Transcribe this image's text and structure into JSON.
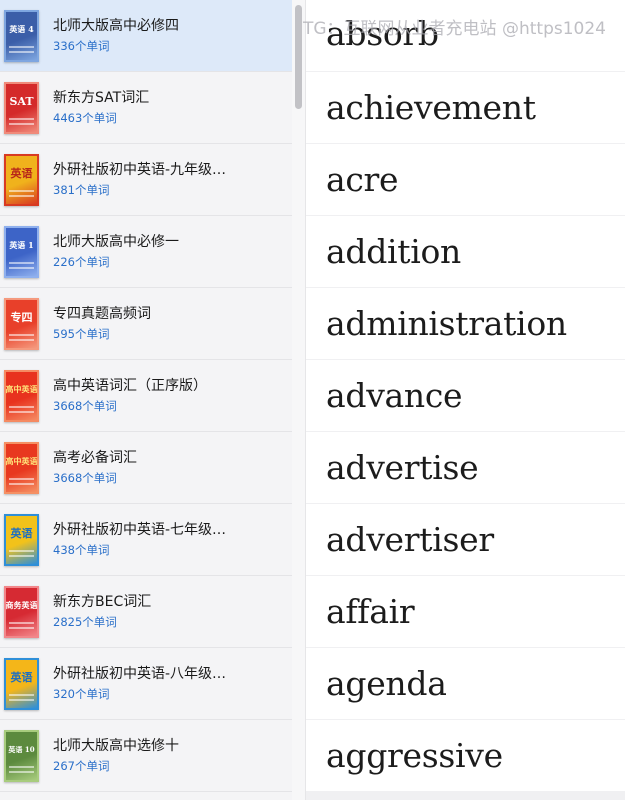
{
  "books": [
    {
      "title": "北师大版高中必修四",
      "count": "336个单词",
      "cover_text": "英语 4",
      "cover_bg": "#3b5ea8",
      "cover_accent": "#7ea6e0",
      "cover_text_color": "#ffffff",
      "selected": true
    },
    {
      "title": "新东方SAT词汇",
      "count": "4463个单词",
      "cover_text": "SAT",
      "cover_bg": "#d42a2a",
      "cover_accent": "#f08a7a",
      "cover_text_color": "#ffffff",
      "selected": false
    },
    {
      "title": "外研社版初中英语-九年级…",
      "count": "381个单词",
      "cover_text": "英语",
      "cover_bg": "#f0b21c",
      "cover_accent": "#d83a22",
      "cover_text_color": "#b8261a",
      "selected": false
    },
    {
      "title": "北师大版高中必修一",
      "count": "226个单词",
      "cover_text": "英语 1",
      "cover_bg": "#3d64c7",
      "cover_accent": "#8fb0ee",
      "cover_text_color": "#ffffff",
      "selected": false
    },
    {
      "title": "专四真题高频词",
      "count": "595个单词",
      "cover_text": "专四",
      "cover_bg": "#e8402a",
      "cover_accent": "#f59a7e",
      "cover_text_color": "#ffffff",
      "selected": false
    },
    {
      "title": "高中英语词汇（正序版）",
      "count": "3668个单词",
      "cover_text": "高中英语",
      "cover_bg": "#e8321e",
      "cover_accent": "#f58a62",
      "cover_text_color": "#ffe27a",
      "selected": false
    },
    {
      "title": "高考必备词汇",
      "count": "3668个单词",
      "cover_text": "高中英语",
      "cover_bg": "#e8381f",
      "cover_accent": "#f59064",
      "cover_text_color": "#ffe27a",
      "selected": false
    },
    {
      "title": "外研社版初中英语-七年级…",
      "count": "438个单词",
      "cover_text": "英语",
      "cover_bg": "#f2c21a",
      "cover_accent": "#2f8fd8",
      "cover_text_color": "#1e6fc0",
      "selected": false
    },
    {
      "title": "新东方BEC词汇",
      "count": "2825个单词",
      "cover_text": "商务英语",
      "cover_bg": "#d62a33",
      "cover_accent": "#f2868a",
      "cover_text_color": "#ffffff",
      "selected": false
    },
    {
      "title": "外研社版初中英语-八年级…",
      "count": "320个单词",
      "cover_text": "英语",
      "cover_bg": "#f4b619",
      "cover_accent": "#2f8fd8",
      "cover_text_color": "#1e6fc0",
      "selected": false
    },
    {
      "title": "北师大版高中选修十",
      "count": "267个单词",
      "cover_text": "英语 10",
      "cover_bg": "#5c8a3e",
      "cover_accent": "#a8cc7e",
      "cover_text_color": "#ffffff",
      "selected": false
    }
  ],
  "words": [
    "absorb",
    "achievement",
    "acre",
    "addition",
    "administration",
    "advance",
    "advertise",
    "advertiser",
    "affair",
    "agenda",
    "aggressive"
  ],
  "watermark": "TG：互联网从业者充电站 @https1024",
  "colors": {
    "selected_bg": "#dde9f9",
    "count_blue": "#2a6fc9"
  }
}
